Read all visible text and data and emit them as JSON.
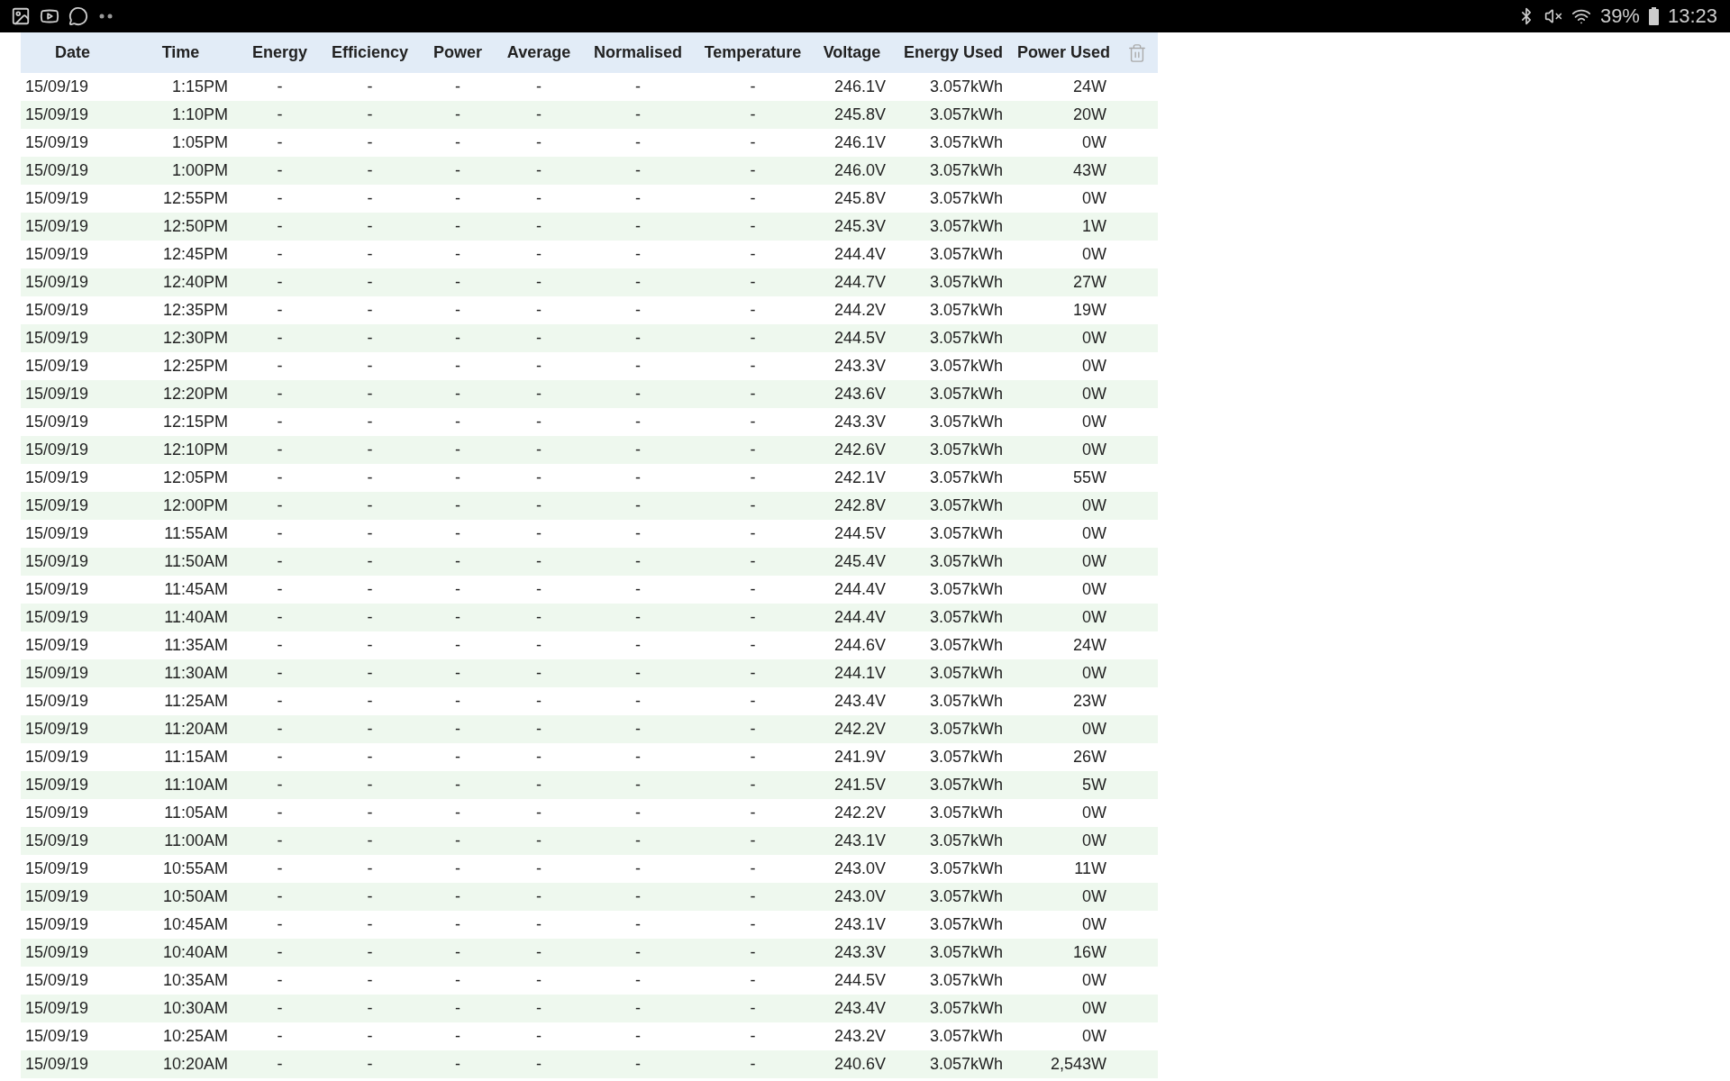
{
  "status_bar": {
    "battery": "39%",
    "time": "13:23"
  },
  "table": {
    "columns": [
      "Date",
      "Time",
      "Energy",
      "Efficiency",
      "Power",
      "Average",
      "Normalised",
      "Temperature",
      "Voltage",
      "Energy Used",
      "Power Used"
    ],
    "rows": [
      [
        "15/09/19",
        "1:15PM",
        "-",
        "-",
        "-",
        "-",
        "-",
        "-",
        "246.1V",
        "3.057kWh",
        "24W"
      ],
      [
        "15/09/19",
        "1:10PM",
        "-",
        "-",
        "-",
        "-",
        "-",
        "-",
        "245.8V",
        "3.057kWh",
        "20W"
      ],
      [
        "15/09/19",
        "1:05PM",
        "-",
        "-",
        "-",
        "-",
        "-",
        "-",
        "246.1V",
        "3.057kWh",
        "0W"
      ],
      [
        "15/09/19",
        "1:00PM",
        "-",
        "-",
        "-",
        "-",
        "-",
        "-",
        "246.0V",
        "3.057kWh",
        "43W"
      ],
      [
        "15/09/19",
        "12:55PM",
        "-",
        "-",
        "-",
        "-",
        "-",
        "-",
        "245.8V",
        "3.057kWh",
        "0W"
      ],
      [
        "15/09/19",
        "12:50PM",
        "-",
        "-",
        "-",
        "-",
        "-",
        "-",
        "245.3V",
        "3.057kWh",
        "1W"
      ],
      [
        "15/09/19",
        "12:45PM",
        "-",
        "-",
        "-",
        "-",
        "-",
        "-",
        "244.4V",
        "3.057kWh",
        "0W"
      ],
      [
        "15/09/19",
        "12:40PM",
        "-",
        "-",
        "-",
        "-",
        "-",
        "-",
        "244.7V",
        "3.057kWh",
        "27W"
      ],
      [
        "15/09/19",
        "12:35PM",
        "-",
        "-",
        "-",
        "-",
        "-",
        "-",
        "244.2V",
        "3.057kWh",
        "19W"
      ],
      [
        "15/09/19",
        "12:30PM",
        "-",
        "-",
        "-",
        "-",
        "-",
        "-",
        "244.5V",
        "3.057kWh",
        "0W"
      ],
      [
        "15/09/19",
        "12:25PM",
        "-",
        "-",
        "-",
        "-",
        "-",
        "-",
        "243.3V",
        "3.057kWh",
        "0W"
      ],
      [
        "15/09/19",
        "12:20PM",
        "-",
        "-",
        "-",
        "-",
        "-",
        "-",
        "243.6V",
        "3.057kWh",
        "0W"
      ],
      [
        "15/09/19",
        "12:15PM",
        "-",
        "-",
        "-",
        "-",
        "-",
        "-",
        "243.3V",
        "3.057kWh",
        "0W"
      ],
      [
        "15/09/19",
        "12:10PM",
        "-",
        "-",
        "-",
        "-",
        "-",
        "-",
        "242.6V",
        "3.057kWh",
        "0W"
      ],
      [
        "15/09/19",
        "12:05PM",
        "-",
        "-",
        "-",
        "-",
        "-",
        "-",
        "242.1V",
        "3.057kWh",
        "55W"
      ],
      [
        "15/09/19",
        "12:00PM",
        "-",
        "-",
        "-",
        "-",
        "-",
        "-",
        "242.8V",
        "3.057kWh",
        "0W"
      ],
      [
        "15/09/19",
        "11:55AM",
        "-",
        "-",
        "-",
        "-",
        "-",
        "-",
        "244.5V",
        "3.057kWh",
        "0W"
      ],
      [
        "15/09/19",
        "11:50AM",
        "-",
        "-",
        "-",
        "-",
        "-",
        "-",
        "245.4V",
        "3.057kWh",
        "0W"
      ],
      [
        "15/09/19",
        "11:45AM",
        "-",
        "-",
        "-",
        "-",
        "-",
        "-",
        "244.4V",
        "3.057kWh",
        "0W"
      ],
      [
        "15/09/19",
        "11:40AM",
        "-",
        "-",
        "-",
        "-",
        "-",
        "-",
        "244.4V",
        "3.057kWh",
        "0W"
      ],
      [
        "15/09/19",
        "11:35AM",
        "-",
        "-",
        "-",
        "-",
        "-",
        "-",
        "244.6V",
        "3.057kWh",
        "24W"
      ],
      [
        "15/09/19",
        "11:30AM",
        "-",
        "-",
        "-",
        "-",
        "-",
        "-",
        "244.1V",
        "3.057kWh",
        "0W"
      ],
      [
        "15/09/19",
        "11:25AM",
        "-",
        "-",
        "-",
        "-",
        "-",
        "-",
        "243.4V",
        "3.057kWh",
        "23W"
      ],
      [
        "15/09/19",
        "11:20AM",
        "-",
        "-",
        "-",
        "-",
        "-",
        "-",
        "242.2V",
        "3.057kWh",
        "0W"
      ],
      [
        "15/09/19",
        "11:15AM",
        "-",
        "-",
        "-",
        "-",
        "-",
        "-",
        "241.9V",
        "3.057kWh",
        "26W"
      ],
      [
        "15/09/19",
        "11:10AM",
        "-",
        "-",
        "-",
        "-",
        "-",
        "-",
        "241.5V",
        "3.057kWh",
        "5W"
      ],
      [
        "15/09/19",
        "11:05AM",
        "-",
        "-",
        "-",
        "-",
        "-",
        "-",
        "242.2V",
        "3.057kWh",
        "0W"
      ],
      [
        "15/09/19",
        "11:00AM",
        "-",
        "-",
        "-",
        "-",
        "-",
        "-",
        "243.1V",
        "3.057kWh",
        "0W"
      ],
      [
        "15/09/19",
        "10:55AM",
        "-",
        "-",
        "-",
        "-",
        "-",
        "-",
        "243.0V",
        "3.057kWh",
        "11W"
      ],
      [
        "15/09/19",
        "10:50AM",
        "-",
        "-",
        "-",
        "-",
        "-",
        "-",
        "243.0V",
        "3.057kWh",
        "0W"
      ],
      [
        "15/09/19",
        "10:45AM",
        "-",
        "-",
        "-",
        "-",
        "-",
        "-",
        "243.1V",
        "3.057kWh",
        "0W"
      ],
      [
        "15/09/19",
        "10:40AM",
        "-",
        "-",
        "-",
        "-",
        "-",
        "-",
        "243.3V",
        "3.057kWh",
        "16W"
      ],
      [
        "15/09/19",
        "10:35AM",
        "-",
        "-",
        "-",
        "-",
        "-",
        "-",
        "244.5V",
        "3.057kWh",
        "0W"
      ],
      [
        "15/09/19",
        "10:30AM",
        "-",
        "-",
        "-",
        "-",
        "-",
        "-",
        "243.4V",
        "3.057kWh",
        "0W"
      ],
      [
        "15/09/19",
        "10:25AM",
        "-",
        "-",
        "-",
        "-",
        "-",
        "-",
        "243.2V",
        "3.057kWh",
        "0W"
      ],
      [
        "15/09/19",
        "10:20AM",
        "-",
        "-",
        "-",
        "-",
        "-",
        "-",
        "240.6V",
        "3.057kWh",
        "2,543W"
      ]
    ]
  }
}
